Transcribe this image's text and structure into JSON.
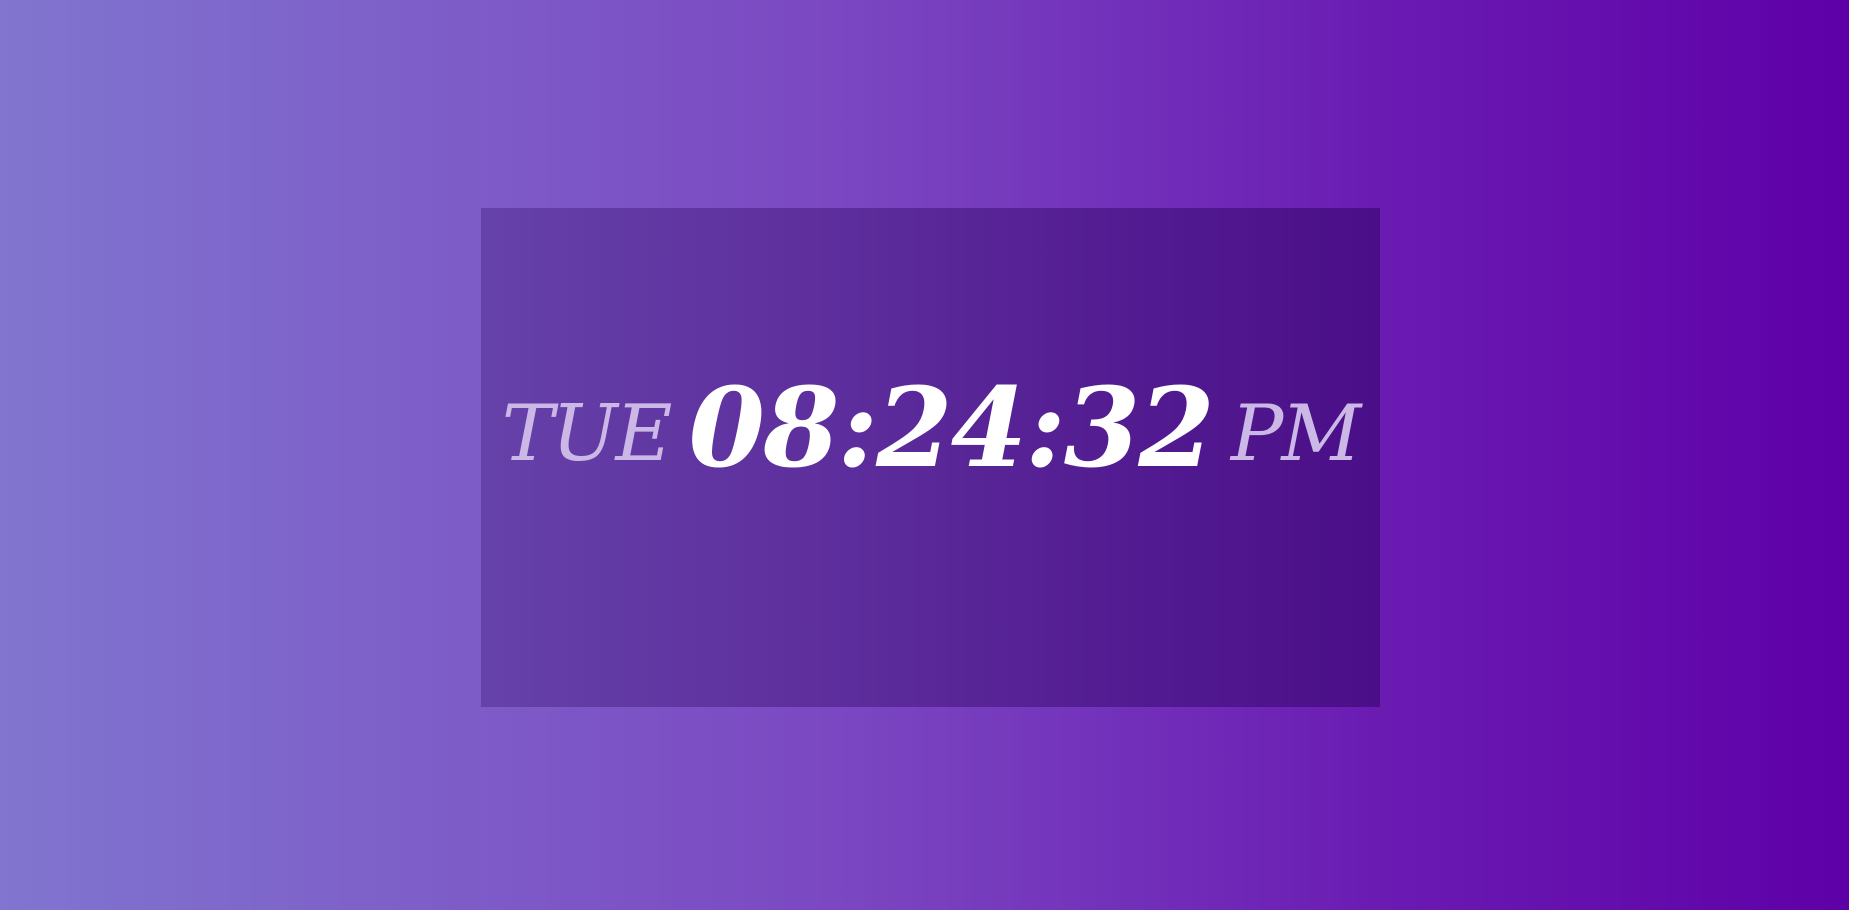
{
  "clock": {
    "day": "TUE",
    "time": "08:24:32",
    "period": "PM"
  },
  "colors": {
    "background_start": "#8075cf",
    "background_end": "#5e00a8",
    "time_text": "#ffffff",
    "secondary_text": "#cbb8e6"
  }
}
